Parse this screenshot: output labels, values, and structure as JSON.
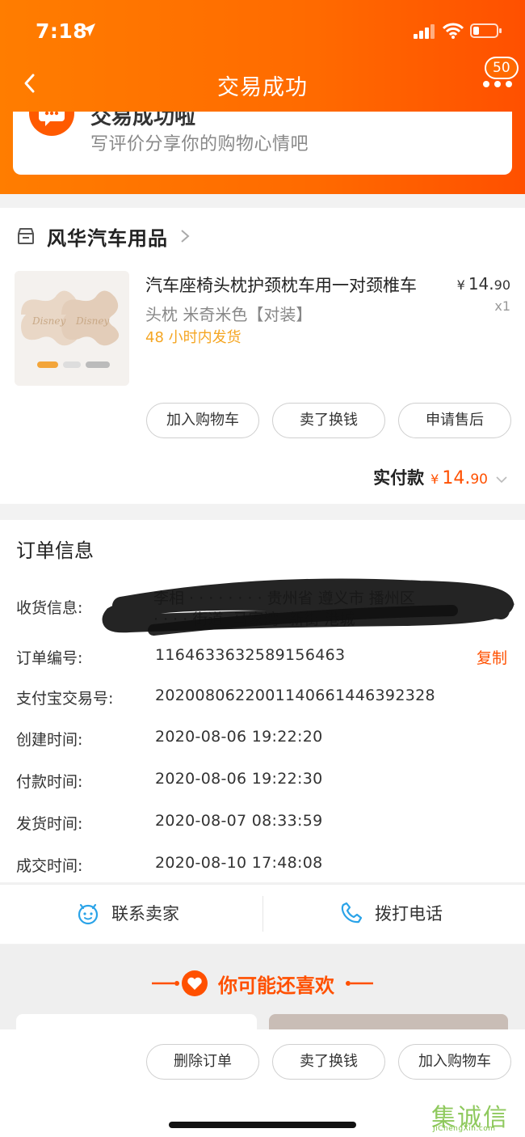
{
  "status_bar": {
    "time": "7:18"
  },
  "nav": {
    "title": "交易成功",
    "badge": "50"
  },
  "success": {
    "heading": "交易成功啦",
    "subtitle": "写评价分享你的购物心情吧"
  },
  "shop": {
    "name": "风华汽车用品",
    "product": {
      "title": "汽车座椅头枕护颈枕车用一对颈椎车",
      "spec": "头枕 米奇米色【对装】",
      "shipping": "48 小时内发货",
      "price_currency": "¥",
      "price_int": "14.",
      "price_dec": "90",
      "qty": "x1"
    },
    "actions": [
      "加入购物车",
      "卖了换钱",
      "申请售后"
    ],
    "paid": {
      "label": "实付款",
      "currency": "¥",
      "int": "14.",
      "dec": "90"
    }
  },
  "order": {
    "heading": "订单信息",
    "address_label": "收货信息:",
    "address_line1": "李相  ·  · · · · · · · 贵州省  遵义市  播州区",
    "address_line2": "· · · · 街道  ·马家湾  ·新街  港城",
    "rows": [
      {
        "label": "订单编号:",
        "value": "1164633632589156463"
      },
      {
        "label": "支付宝交易号:",
        "value": "2020080622001140661446392328"
      },
      {
        "label": "创建时间:",
        "value": "2020-08-06 19:22:20"
      },
      {
        "label": "付款时间:",
        "value": "2020-08-06 19:22:30"
      },
      {
        "label": "发货时间:",
        "value": "2020-08-07 08:33:59"
      },
      {
        "label": "成交时间:",
        "value": "2020-08-10 17:48:08"
      }
    ],
    "copy_label": "复制"
  },
  "contact": {
    "seller": "联系卖家",
    "phone": "拨打电话"
  },
  "reco": {
    "title": "你可能还喜欢"
  },
  "bottom_actions": [
    "删除订单",
    "卖了换钱",
    "加入购物车"
  ],
  "watermark": {
    "big": "集诚信",
    "small": "JiChengXin.com"
  },
  "colors": {
    "accent": "#ff5000",
    "header": "#ff7d00",
    "ship": "#f5a623"
  }
}
